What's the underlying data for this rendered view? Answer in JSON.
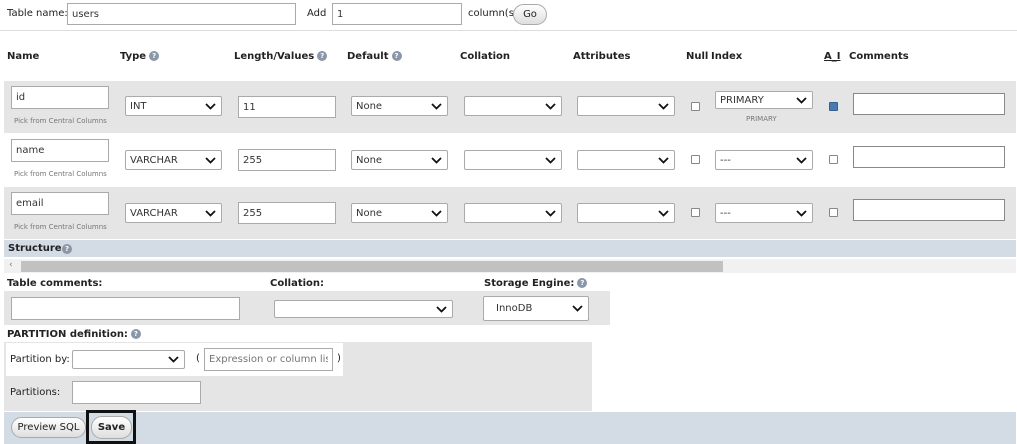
{
  "top": {
    "table_name_label": "Table name:",
    "table_name_value": "users",
    "add_label": "Add",
    "add_value": "1",
    "columns_label": "column(s)",
    "go_label": "Go"
  },
  "headers": {
    "name": "Name",
    "type": "Type",
    "length": "Length/Values",
    "default": "Default",
    "collation": "Collation",
    "attributes": "Attributes",
    "null": "Null",
    "index": "Index",
    "ai": "A_I",
    "comments": "Comments"
  },
  "rows": [
    {
      "name": "id",
      "pick": "Pick from Central Columns",
      "type": "INT",
      "length": "11",
      "default": "None",
      "collation": "",
      "attributes": "",
      "null": false,
      "index": "PRIMARY",
      "index_sub": "PRIMARY",
      "ai": true
    },
    {
      "name": "name",
      "pick": "Pick from Central Columns",
      "type": "VARCHAR",
      "length": "255",
      "default": "None",
      "collation": "",
      "attributes": "",
      "null": false,
      "index": "---",
      "index_sub": "",
      "ai": false
    },
    {
      "name": "email",
      "pick": "Pick from Central Columns",
      "type": "VARCHAR",
      "length": "255",
      "default": "None",
      "collation": "",
      "attributes": "",
      "null": false,
      "index": "---",
      "index_sub": "",
      "ai": false
    }
  ],
  "structure": {
    "label": "Structure"
  },
  "table_opts": {
    "comments_label": "Table comments:",
    "comments_value": "",
    "collation_label": "Collation:",
    "collation_value": "",
    "engine_label": "Storage Engine:",
    "engine_value": "InnoDB"
  },
  "partition": {
    "label": "PARTITION definition:",
    "by_label": "Partition by:",
    "by_value": "",
    "open_paren": "(",
    "close_paren": ")",
    "expression_placeholder": "Expression or column list",
    "partitions_label": "Partitions:",
    "partitions_value": ""
  },
  "buttons": {
    "preview": "Preview SQL",
    "save": "Save"
  },
  "colors": {
    "row_bg": "#e5e5e5",
    "structure_bar": "#d3dce4",
    "footer_bg": "#d3dce4",
    "checkbox_checked": "#4a78b0"
  }
}
